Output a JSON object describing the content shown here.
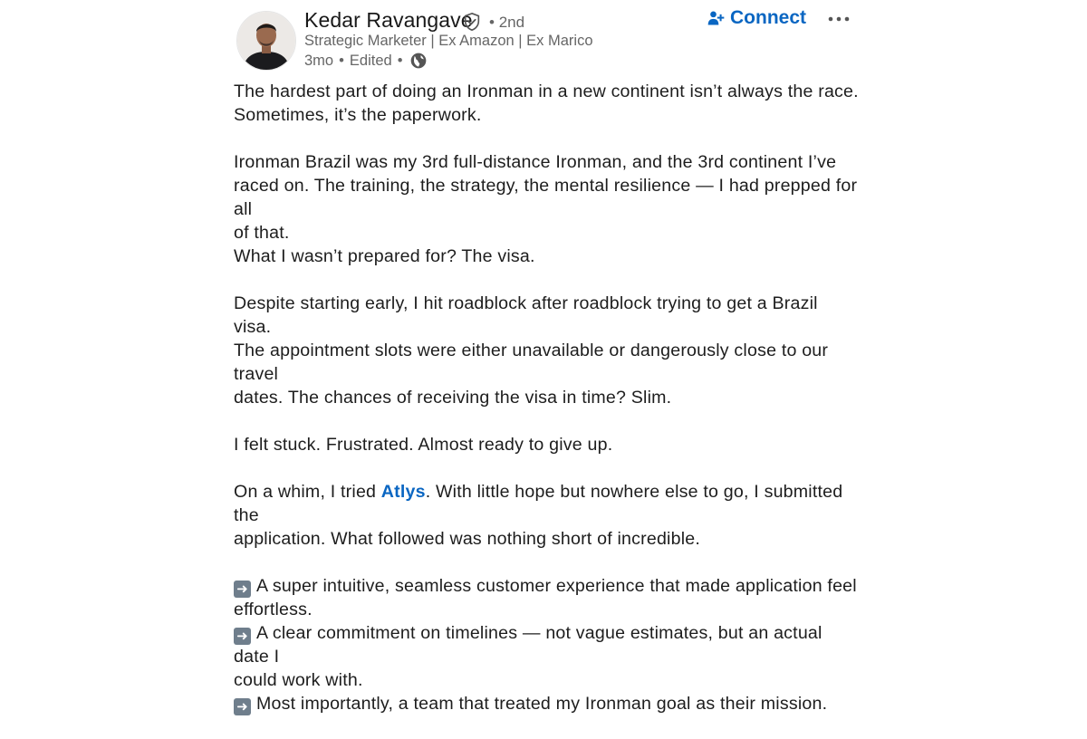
{
  "author": {
    "name": "Kedar Ravangave",
    "degree": "2nd",
    "headline": "Strategic Marketer | Ex Amazon | Ex Marico",
    "time": "3mo",
    "edited": "Edited"
  },
  "actions": {
    "connect_label": "Connect"
  },
  "post": {
    "p1": [
      "The hardest part of doing an Ironman in a new continent isn’t always the race.",
      "Sometimes, it’s the paperwork."
    ],
    "p2": [
      "Ironman Brazil was my 3rd full-distance Ironman, and the 3rd continent I’ve",
      "raced on. The training, the strategy, the mental resilience — I had prepped for all",
      "of that.",
      "What I wasn’t prepared for? The visa."
    ],
    "p3": [
      "Despite starting early, I hit roadblock after roadblock trying to get a Brazil visa.",
      "The appointment slots were either unavailable or dangerously close to our travel",
      "dates. The chances of receiving the visa in time? Slim."
    ],
    "p4": "I felt stuck. Frustrated. Almost ready to give up.",
    "p5": {
      "before": "On a whim, I tried ",
      "link": "Atlys",
      "after": ". With little hope but nowhere else to go, I submitted the",
      "line2": "application. What followed was nothing short of incredible."
    },
    "bullets": {
      "b1a": "A super intuitive, seamless customer experience that made application feel",
      "b1b": "effortless.",
      "b2a": "A clear commitment on timelines — not vague estimates, but an actual date I",
      "b2b": "could work with.",
      "b3": "Most importantly, a team that treated my Ironman goal as their mission."
    }
  },
  "icons": {
    "verified": "verified-shield-icon",
    "globe": "globe-icon",
    "connect": "add-person-icon",
    "more": "more-horizontal-icon",
    "bullet": "right-arrow-emoji-icon"
  },
  "colors": {
    "accent": "#0a66c2",
    "secondary_text": "#666666"
  }
}
